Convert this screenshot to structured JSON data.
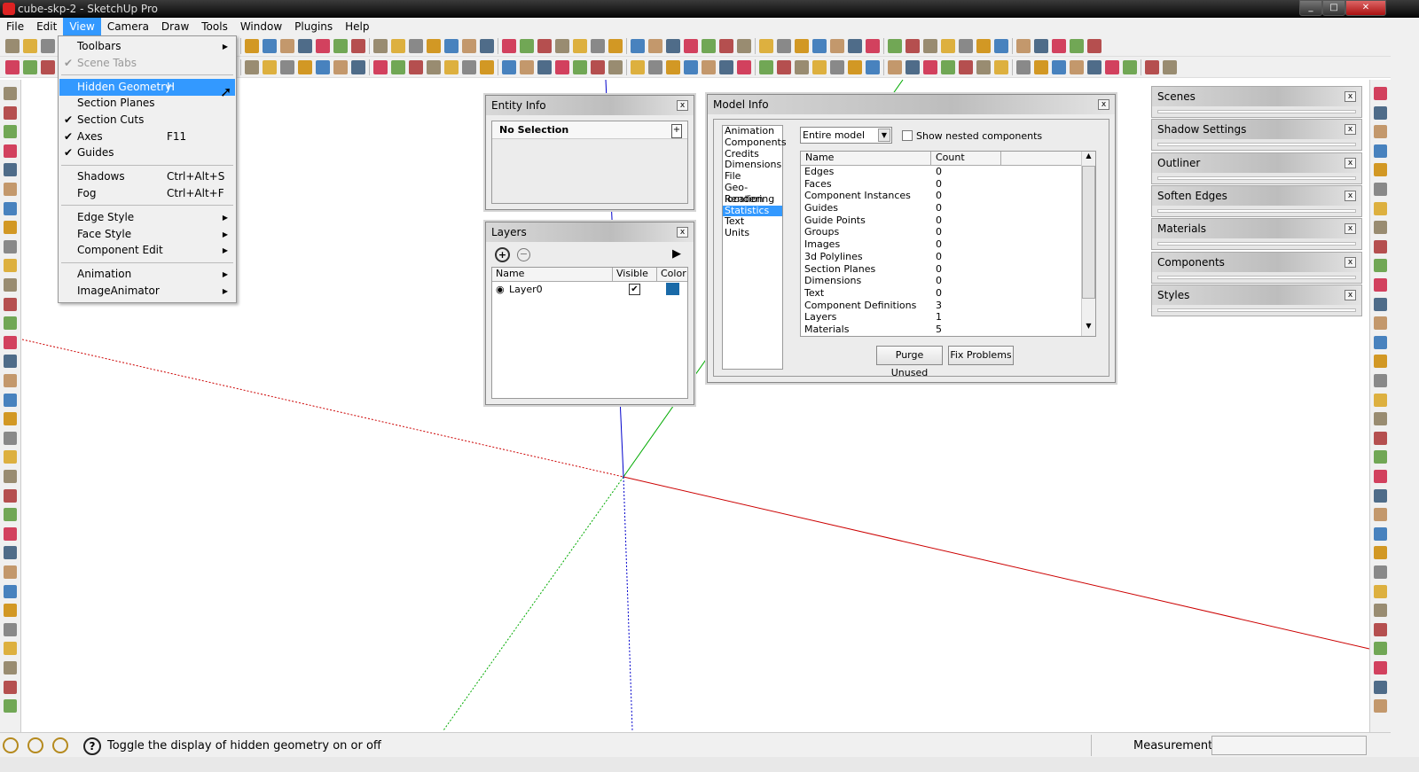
{
  "window": {
    "title": "cube-skp-2 - SketchUp Pro",
    "controls": [
      "minimize",
      "maximize",
      "close"
    ]
  },
  "menubar": [
    "File",
    "Edit",
    "View",
    "Camera",
    "Draw",
    "Tools",
    "Window",
    "Plugins",
    "Help"
  ],
  "view_menu": {
    "items": [
      {
        "label": "Toolbars",
        "submenu": true
      },
      {
        "label": "Scene Tabs",
        "checked": true,
        "disabled": true
      },
      {
        "label": "Hidden Geometry",
        "shortcut": "H",
        "highlighted": true
      },
      {
        "label": "Section Planes"
      },
      {
        "label": "Section Cuts",
        "checked": true
      },
      {
        "label": "Axes",
        "checked": true,
        "shortcut": "F11"
      },
      {
        "label": "Guides",
        "checked": true
      },
      {
        "label": "Shadows",
        "shortcut": "Ctrl+Alt+S"
      },
      {
        "label": "Fog",
        "shortcut": "Ctrl+Alt+F"
      },
      {
        "label": "Edge Style",
        "submenu": true
      },
      {
        "label": "Face Style",
        "submenu": true
      },
      {
        "label": "Component Edit",
        "submenu": true
      },
      {
        "label": "Animation",
        "submenu": true
      },
      {
        "label": "ImageAnimator",
        "submenu": true
      }
    ]
  },
  "entity_info": {
    "title": "Entity Info",
    "selection": "No Selection"
  },
  "layers": {
    "title": "Layers",
    "columns": [
      "Name",
      "Visible",
      "Color"
    ],
    "rows": [
      {
        "name": "Layer0",
        "visible": true,
        "color": "#1a6aa8"
      }
    ]
  },
  "model_info": {
    "title": "Model Info",
    "nav": [
      "Animation",
      "Components",
      "Credits",
      "Dimensions",
      "File",
      "Geo-location",
      "Rendering",
      "Statistics",
      "Text",
      "Units"
    ],
    "selected_nav": "Statistics",
    "scope": "Entire model",
    "show_nested_label": "Show nested components",
    "show_nested": false,
    "columns": [
      "Name",
      "Count"
    ],
    "rows": [
      [
        "Edges",
        "0"
      ],
      [
        "Faces",
        "0"
      ],
      [
        "Component Instances",
        "0"
      ],
      [
        "Guides",
        "0"
      ],
      [
        "Guide Points",
        "0"
      ],
      [
        "Groups",
        "0"
      ],
      [
        "Images",
        "0"
      ],
      [
        "3d Polylines",
        "0"
      ],
      [
        "Section Planes",
        "0"
      ],
      [
        "Dimensions",
        "0"
      ],
      [
        "Text",
        "0"
      ],
      [
        "Component Definitions",
        "3"
      ],
      [
        "Layers",
        "1"
      ],
      [
        "Materials",
        "5"
      ]
    ],
    "purge_label": "Purge Unused",
    "fix_label": "Fix Problems"
  },
  "tray": [
    "Scenes",
    "Shadow Settings",
    "Outliner",
    "Soften Edges",
    "Materials",
    "Components",
    "Styles"
  ],
  "status": {
    "hint": "Toggle the display of hidden geometry on or off",
    "measurements_label": "Measurements",
    "measurements_value": ""
  },
  "colors": {
    "x_axis": "#cc0000",
    "y_axis": "#00aa00",
    "z_axis": "#0000cc",
    "highlight": "#3399ff"
  }
}
